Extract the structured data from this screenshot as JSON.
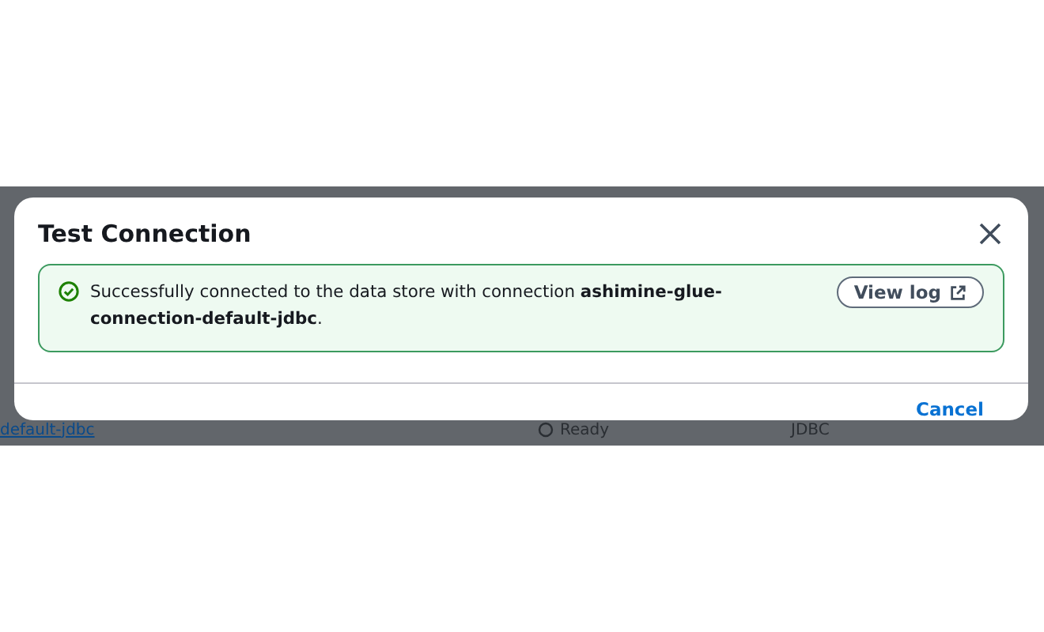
{
  "dialog": {
    "title": "Test Connection",
    "alert": {
      "kind": "success",
      "message": "Successfully connected to the data store with connection **ashimine-glue-connection-default-jdbc**.",
      "action": "View log"
    },
    "footer_button": "Cancel"
  },
  "background_row": {
    "name": "default-jdbc",
    "status": "Ready",
    "type": "JDBC"
  }
}
